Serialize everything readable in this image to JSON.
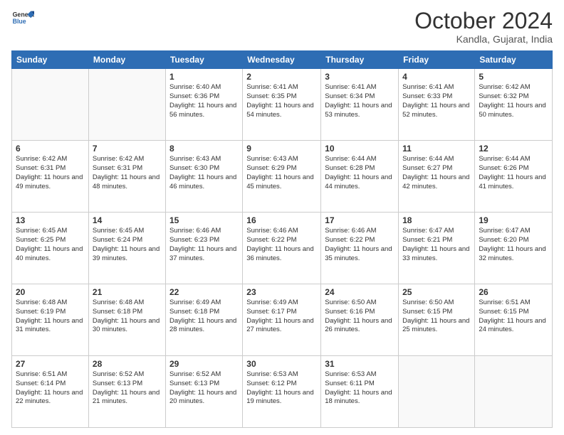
{
  "logo": {
    "general": "General",
    "blue": "Blue"
  },
  "header": {
    "month": "October 2024",
    "location": "Kandla, Gujarat, India"
  },
  "weekdays": [
    "Sunday",
    "Monday",
    "Tuesday",
    "Wednesday",
    "Thursday",
    "Friday",
    "Saturday"
  ],
  "weeks": [
    [
      {
        "day": "",
        "sunrise": "",
        "sunset": "",
        "daylight": "",
        "empty": true
      },
      {
        "day": "",
        "sunrise": "",
        "sunset": "",
        "daylight": "",
        "empty": true
      },
      {
        "day": "1",
        "sunrise": "Sunrise: 6:40 AM",
        "sunset": "Sunset: 6:36 PM",
        "daylight": "Daylight: 11 hours and 56 minutes.",
        "empty": false
      },
      {
        "day": "2",
        "sunrise": "Sunrise: 6:41 AM",
        "sunset": "Sunset: 6:35 PM",
        "daylight": "Daylight: 11 hours and 54 minutes.",
        "empty": false
      },
      {
        "day": "3",
        "sunrise": "Sunrise: 6:41 AM",
        "sunset": "Sunset: 6:34 PM",
        "daylight": "Daylight: 11 hours and 53 minutes.",
        "empty": false
      },
      {
        "day": "4",
        "sunrise": "Sunrise: 6:41 AM",
        "sunset": "Sunset: 6:33 PM",
        "daylight": "Daylight: 11 hours and 52 minutes.",
        "empty": false
      },
      {
        "day": "5",
        "sunrise": "Sunrise: 6:42 AM",
        "sunset": "Sunset: 6:32 PM",
        "daylight": "Daylight: 11 hours and 50 minutes.",
        "empty": false
      }
    ],
    [
      {
        "day": "6",
        "sunrise": "Sunrise: 6:42 AM",
        "sunset": "Sunset: 6:31 PM",
        "daylight": "Daylight: 11 hours and 49 minutes.",
        "empty": false
      },
      {
        "day": "7",
        "sunrise": "Sunrise: 6:42 AM",
        "sunset": "Sunset: 6:31 PM",
        "daylight": "Daylight: 11 hours and 48 minutes.",
        "empty": false
      },
      {
        "day": "8",
        "sunrise": "Sunrise: 6:43 AM",
        "sunset": "Sunset: 6:30 PM",
        "daylight": "Daylight: 11 hours and 46 minutes.",
        "empty": false
      },
      {
        "day": "9",
        "sunrise": "Sunrise: 6:43 AM",
        "sunset": "Sunset: 6:29 PM",
        "daylight": "Daylight: 11 hours and 45 minutes.",
        "empty": false
      },
      {
        "day": "10",
        "sunrise": "Sunrise: 6:44 AM",
        "sunset": "Sunset: 6:28 PM",
        "daylight": "Daylight: 11 hours and 44 minutes.",
        "empty": false
      },
      {
        "day": "11",
        "sunrise": "Sunrise: 6:44 AM",
        "sunset": "Sunset: 6:27 PM",
        "daylight": "Daylight: 11 hours and 42 minutes.",
        "empty": false
      },
      {
        "day": "12",
        "sunrise": "Sunrise: 6:44 AM",
        "sunset": "Sunset: 6:26 PM",
        "daylight": "Daylight: 11 hours and 41 minutes.",
        "empty": false
      }
    ],
    [
      {
        "day": "13",
        "sunrise": "Sunrise: 6:45 AM",
        "sunset": "Sunset: 6:25 PM",
        "daylight": "Daylight: 11 hours and 40 minutes.",
        "empty": false
      },
      {
        "day": "14",
        "sunrise": "Sunrise: 6:45 AM",
        "sunset": "Sunset: 6:24 PM",
        "daylight": "Daylight: 11 hours and 39 minutes.",
        "empty": false
      },
      {
        "day": "15",
        "sunrise": "Sunrise: 6:46 AM",
        "sunset": "Sunset: 6:23 PM",
        "daylight": "Daylight: 11 hours and 37 minutes.",
        "empty": false
      },
      {
        "day": "16",
        "sunrise": "Sunrise: 6:46 AM",
        "sunset": "Sunset: 6:22 PM",
        "daylight": "Daylight: 11 hours and 36 minutes.",
        "empty": false
      },
      {
        "day": "17",
        "sunrise": "Sunrise: 6:46 AM",
        "sunset": "Sunset: 6:22 PM",
        "daylight": "Daylight: 11 hours and 35 minutes.",
        "empty": false
      },
      {
        "day": "18",
        "sunrise": "Sunrise: 6:47 AM",
        "sunset": "Sunset: 6:21 PM",
        "daylight": "Daylight: 11 hours and 33 minutes.",
        "empty": false
      },
      {
        "day": "19",
        "sunrise": "Sunrise: 6:47 AM",
        "sunset": "Sunset: 6:20 PM",
        "daylight": "Daylight: 11 hours and 32 minutes.",
        "empty": false
      }
    ],
    [
      {
        "day": "20",
        "sunrise": "Sunrise: 6:48 AM",
        "sunset": "Sunset: 6:19 PM",
        "daylight": "Daylight: 11 hours and 31 minutes.",
        "empty": false
      },
      {
        "day": "21",
        "sunrise": "Sunrise: 6:48 AM",
        "sunset": "Sunset: 6:18 PM",
        "daylight": "Daylight: 11 hours and 30 minutes.",
        "empty": false
      },
      {
        "day": "22",
        "sunrise": "Sunrise: 6:49 AM",
        "sunset": "Sunset: 6:18 PM",
        "daylight": "Daylight: 11 hours and 28 minutes.",
        "empty": false
      },
      {
        "day": "23",
        "sunrise": "Sunrise: 6:49 AM",
        "sunset": "Sunset: 6:17 PM",
        "daylight": "Daylight: 11 hours and 27 minutes.",
        "empty": false
      },
      {
        "day": "24",
        "sunrise": "Sunrise: 6:50 AM",
        "sunset": "Sunset: 6:16 PM",
        "daylight": "Daylight: 11 hours and 26 minutes.",
        "empty": false
      },
      {
        "day": "25",
        "sunrise": "Sunrise: 6:50 AM",
        "sunset": "Sunset: 6:15 PM",
        "daylight": "Daylight: 11 hours and 25 minutes.",
        "empty": false
      },
      {
        "day": "26",
        "sunrise": "Sunrise: 6:51 AM",
        "sunset": "Sunset: 6:15 PM",
        "daylight": "Daylight: 11 hours and 24 minutes.",
        "empty": false
      }
    ],
    [
      {
        "day": "27",
        "sunrise": "Sunrise: 6:51 AM",
        "sunset": "Sunset: 6:14 PM",
        "daylight": "Daylight: 11 hours and 22 minutes.",
        "empty": false
      },
      {
        "day": "28",
        "sunrise": "Sunrise: 6:52 AM",
        "sunset": "Sunset: 6:13 PM",
        "daylight": "Daylight: 11 hours and 21 minutes.",
        "empty": false
      },
      {
        "day": "29",
        "sunrise": "Sunrise: 6:52 AM",
        "sunset": "Sunset: 6:13 PM",
        "daylight": "Daylight: 11 hours and 20 minutes.",
        "empty": false
      },
      {
        "day": "30",
        "sunrise": "Sunrise: 6:53 AM",
        "sunset": "Sunset: 6:12 PM",
        "daylight": "Daylight: 11 hours and 19 minutes.",
        "empty": false
      },
      {
        "day": "31",
        "sunrise": "Sunrise: 6:53 AM",
        "sunset": "Sunset: 6:11 PM",
        "daylight": "Daylight: 11 hours and 18 minutes.",
        "empty": false
      },
      {
        "day": "",
        "sunrise": "",
        "sunset": "",
        "daylight": "",
        "empty": true
      },
      {
        "day": "",
        "sunrise": "",
        "sunset": "",
        "daylight": "",
        "empty": true
      }
    ]
  ]
}
